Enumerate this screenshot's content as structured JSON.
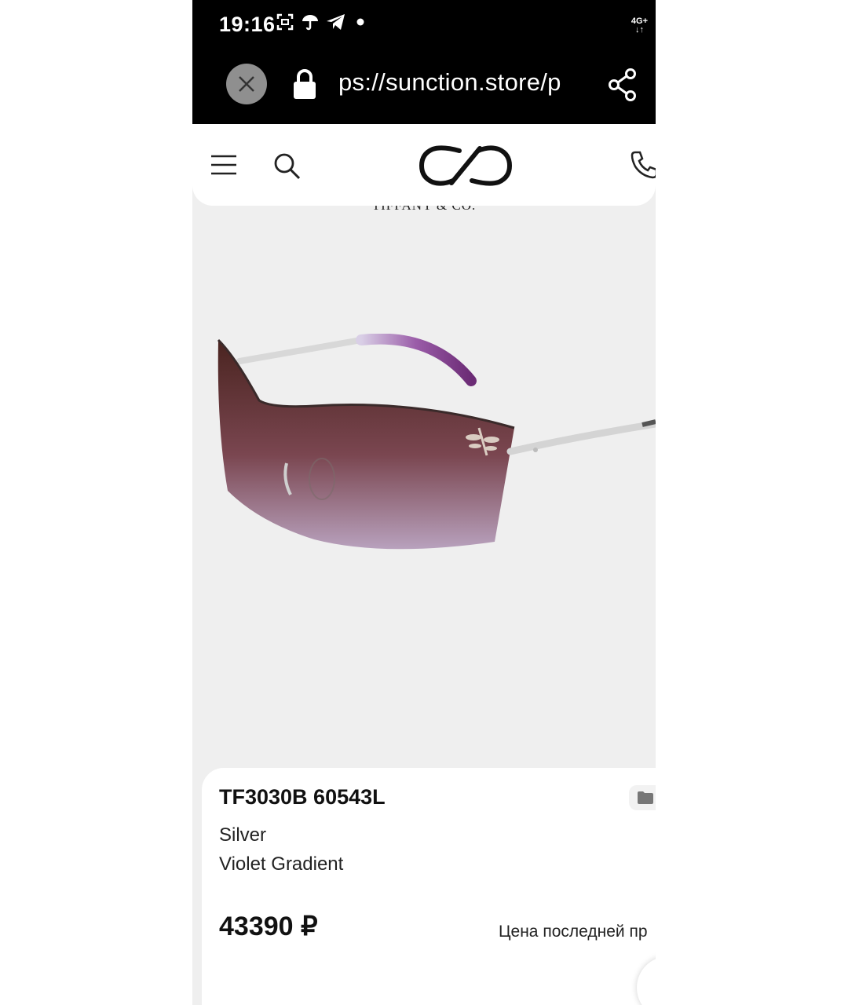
{
  "status_bar": {
    "time": "19:16",
    "network": "4G+"
  },
  "browser": {
    "url": "ps://sunction.store/p"
  },
  "site": {
    "brand_banner": "TIFFANY & CO."
  },
  "product": {
    "title": "TF3030B 60543L",
    "frame_color": "Silver",
    "lens": "Violet Gradient",
    "price": "43390 ₽",
    "last_price_label": "Цена последней пр"
  },
  "colors": {
    "accent": "#000000",
    "card_bg": "#ffffff",
    "image_bg": "#efefef"
  },
  "icons": [
    "close-icon",
    "lock-icon",
    "share-icon",
    "menu-icon",
    "search-icon",
    "logo-icon",
    "phone-icon",
    "folder-icon"
  ]
}
